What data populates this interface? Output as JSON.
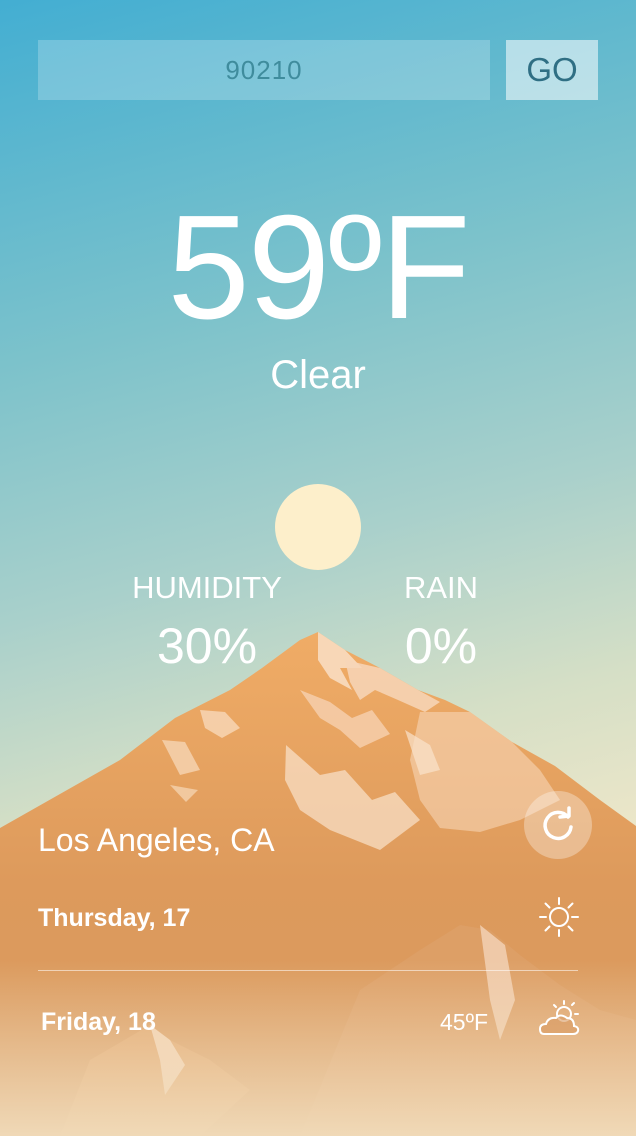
{
  "search": {
    "value": "90210",
    "go_label": "GO"
  },
  "current": {
    "temperature": "59ºF",
    "condition": "Clear"
  },
  "stats": {
    "humidity_label": "HUMIDITY",
    "humidity_value": "30%",
    "rain_label": "RAIN",
    "rain_value": "0%"
  },
  "location": {
    "city": "Los Angeles, CA"
  },
  "forecast": [
    {
      "day": "Thursday, 17",
      "temp": "",
      "icon": "sun-icon"
    },
    {
      "day": "Friday, 18",
      "temp": "45ºF",
      "icon": "partly-cloudy-icon"
    }
  ],
  "colors": {
    "sky_top": "#43aed2",
    "sky_bottom": "#f3e6c6",
    "mountain": "#e59e5e",
    "sun": "#fdefcb"
  }
}
